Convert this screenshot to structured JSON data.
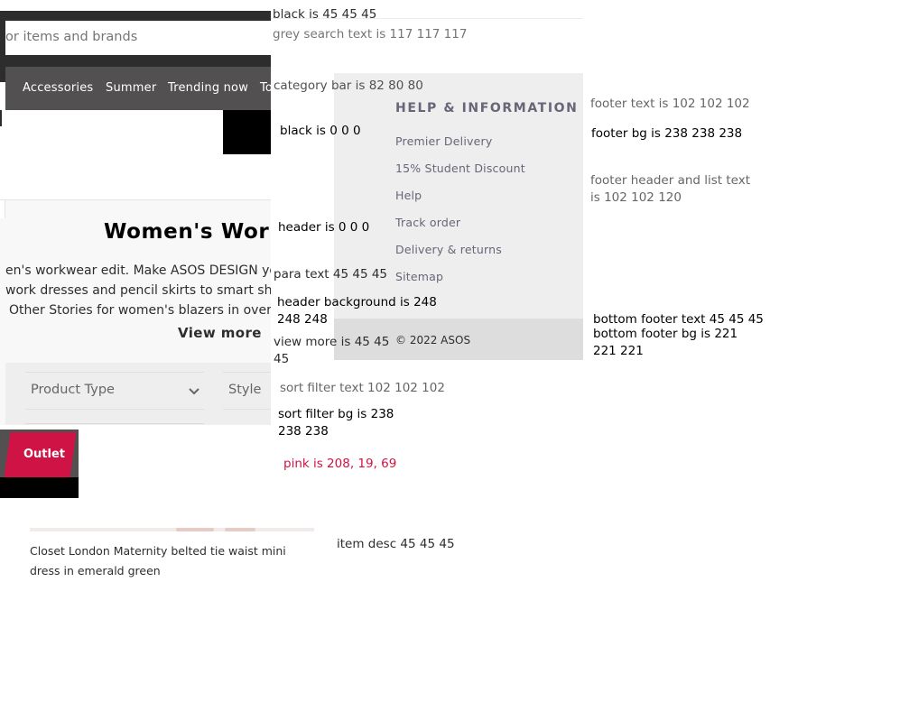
{
  "header": {
    "search_placeholder": "or items and brands",
    "categories": [
      "Accessories",
      "Summer",
      "Trending now",
      "To"
    ]
  },
  "intro": {
    "title": "Women's Work",
    "paragraph_lines": [
      "en's workwear edit. Make ASOS DESIGN yo",
      "work dresses and pencil skirts to smart shoes",
      "Other Stories for women's blazers in oversiz"
    ],
    "view_more": "View more"
  },
  "filters": {
    "items": [
      "Product Type",
      "Style"
    ]
  },
  "outlet": {
    "label": "Outlet"
  },
  "product": {
    "description": "Closet London Maternity belted tie waist mini dress in emerald green"
  },
  "footer": {
    "heading": "HELP & INFORMATION",
    "links": [
      "Premier Delivery",
      "15% Student Discount",
      "Help",
      "Track order",
      "Delivery & returns",
      "Sitemap"
    ],
    "copyright": "© 2022 ASOS"
  },
  "notes": {
    "black": "black is 45 45 45",
    "grey_search": "grey search text is 117 117 117",
    "category_bar": "category bar is 82 80 80",
    "black_000": "black is 0 0 0",
    "header_000": "header is 0 0 0",
    "para_text": "para text 45 45 45",
    "header_bg": "header background is 248 248 248",
    "view_more": "view more is 45 45 45",
    "sort_filter_text": "sort filter text 102 102 102",
    "sort_filter_bg": "sort filter bg is 238 238 238",
    "pink": "pink is 208, 19, 69",
    "item_desc": "item desc 45 45 45",
    "footer_text": "footer text is 102 102 102",
    "footer_bg": "footer bg is 238 238 238",
    "footer_header_list": "footer header and list text is 102 102 120",
    "bottom_footer_text": "bottom footer text 45 45 45",
    "bottom_footer_bg": "bottom footer bg is 221 221 221"
  },
  "colors": {
    "dark": "#2d2d2d",
    "search_grey": "#757575",
    "category_bar": "#525050",
    "black": "#000000",
    "header_bg": "#f8f8f8",
    "filter_text": "#666666",
    "filter_bg": "#eeeeee",
    "pink": "#d01345",
    "footer_list": "#666678",
    "footer_bg": "#eeeeee",
    "bottom_footer_bg": "#dddddd"
  }
}
